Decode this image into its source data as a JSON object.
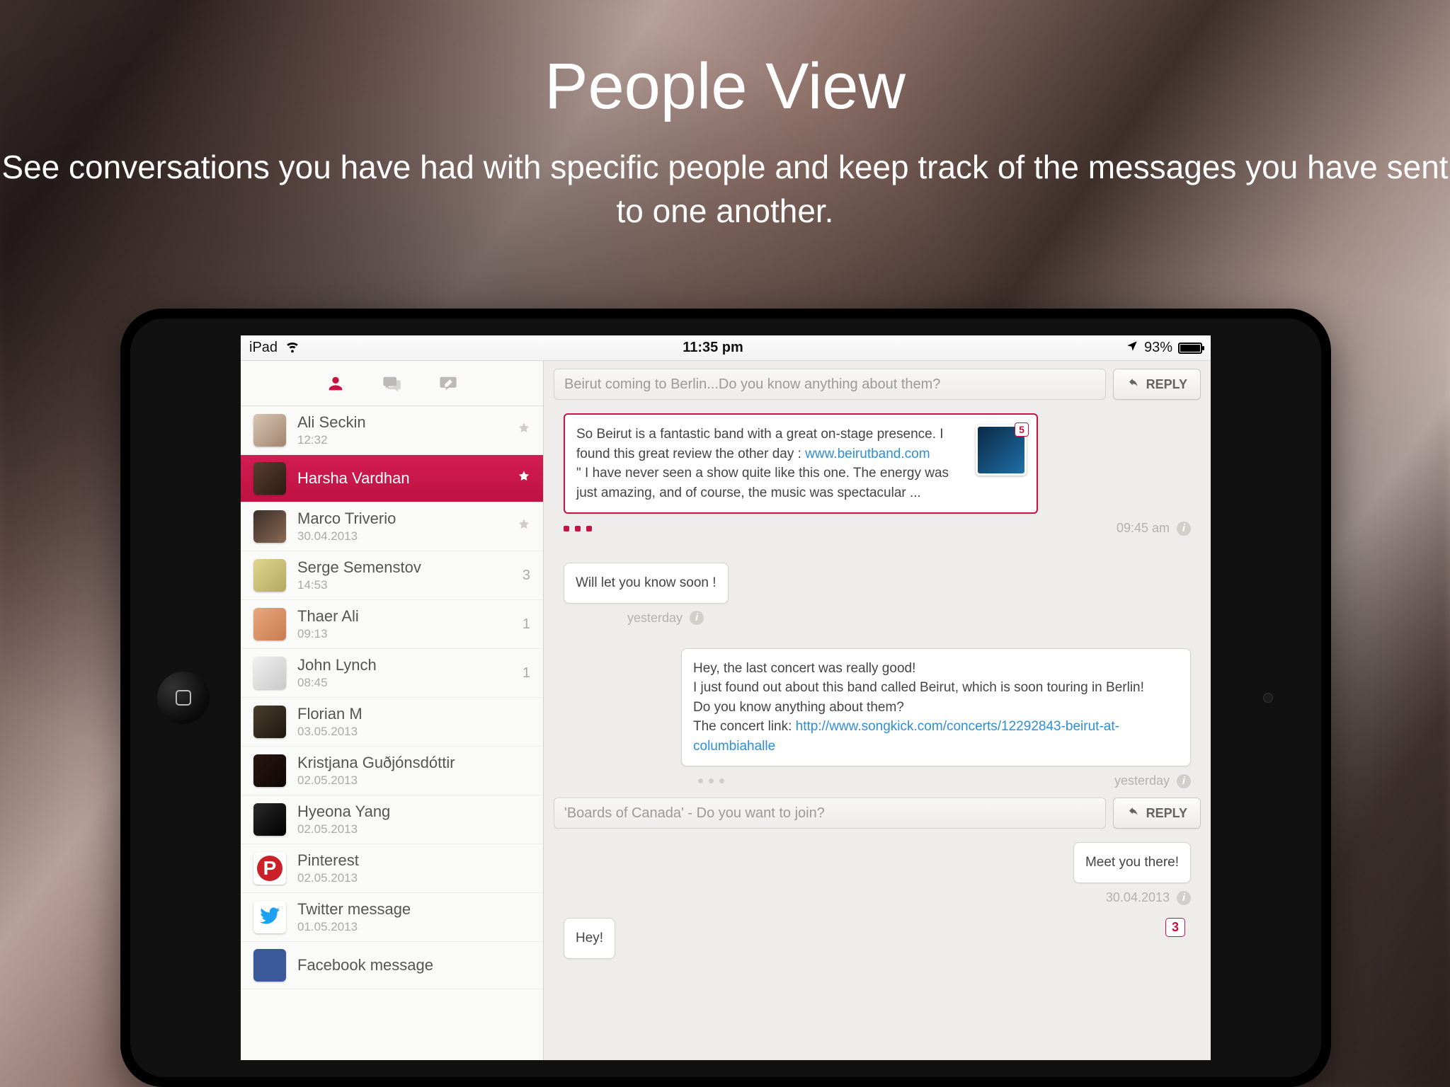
{
  "hero": {
    "title": "People View",
    "subtitle": "See conversations you have had with specific people and keep track of the messages you have sent to one another."
  },
  "statusbar": {
    "device": "iPad",
    "time": "11:35 pm",
    "battery": "93%"
  },
  "sidebar": {
    "people": [
      {
        "name": "Ali Seckin",
        "sub": "12:32",
        "badge": "star",
        "avatar": "av-1"
      },
      {
        "name": "Harsha Vardhan",
        "sub": "",
        "badge": "star-filled",
        "avatar": "av-2",
        "selected": true
      },
      {
        "name": "Marco Triverio",
        "sub": "30.04.2013",
        "badge": "star",
        "avatar": "av-3"
      },
      {
        "name": "Serge Semenstov",
        "sub": "14:53",
        "badge": "3",
        "avatar": "av-4"
      },
      {
        "name": "Thaer Ali",
        "sub": "09:13",
        "badge": "1",
        "avatar": "av-5"
      },
      {
        "name": "John Lynch",
        "sub": "08:45",
        "badge": "1",
        "avatar": "av-6"
      },
      {
        "name": "Florian M",
        "sub": "03.05.2013",
        "badge": "",
        "avatar": "av-7"
      },
      {
        "name": "Kristjana Guðjónsdóttir",
        "sub": "02.05.2013",
        "badge": "",
        "avatar": "av-8"
      },
      {
        "name": "Hyeona Yang",
        "sub": "02.05.2013",
        "badge": "",
        "avatar": "av-9"
      },
      {
        "name": "Pinterest",
        "sub": "02.05.2013",
        "badge": "",
        "avatar": "av-10",
        "icon": "pinterest"
      },
      {
        "name": "Twitter message",
        "sub": "01.05.2013",
        "badge": "",
        "avatar": "av-11",
        "icon": "twitter"
      },
      {
        "name": "Facebook message",
        "sub": "",
        "badge": "",
        "avatar": "av-12",
        "icon": "facebook"
      }
    ]
  },
  "threads": [
    {
      "subject": "Beirut coming to Berlin...Do you know anything about them?",
      "reply_label": "REPLY",
      "messages": [
        {
          "side": "left",
          "highlight": true,
          "text_a": "So Beirut is a fantastic band with a great on-stage presence. I found this great review the other day : ",
          "link_a": "www.beirutband.com",
          "text_b": "\" I have never seen a show quite like this one. The energy was just amazing, and of course, the music was spectacular ...",
          "thumb_count": "5",
          "time": "09:45 am"
        },
        {
          "side": "left",
          "text": "Will let you know soon !",
          "time": "yesterday"
        },
        {
          "side": "right",
          "line1": "Hey, the last concert was really good!",
          "line2": "I just found out about this band called Beirut, which is soon touring in Berlin!",
          "line3": "Do you know anything about them?",
          "line4_a": "The concert link: ",
          "line4_link": "http://www.songkick.com/concerts/12292843-beirut-at-columbiahalle",
          "time": "yesterday"
        }
      ]
    },
    {
      "subject": "'Boards of Canada' - Do you want to join?",
      "reply_label": "REPLY",
      "messages": [
        {
          "side": "right",
          "text": "Meet you there!",
          "time": "30.04.2013",
          "badge": "3"
        },
        {
          "side": "left",
          "text": "Hey!"
        }
      ]
    }
  ]
}
